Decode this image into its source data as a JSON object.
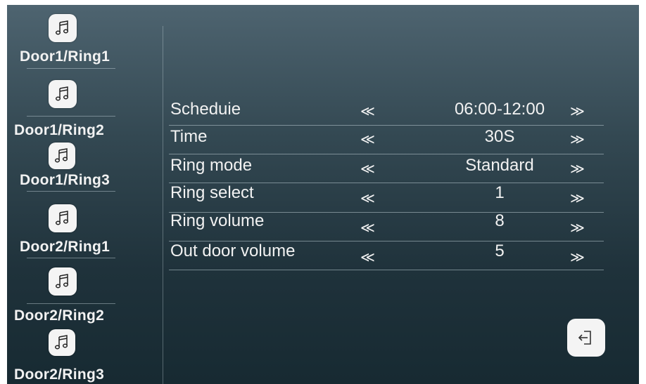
{
  "sidebar": {
    "items": [
      {
        "label": "Door1/Ring1",
        "icon": "music-note-icon"
      },
      {
        "label": "Door1/Ring2",
        "icon": "music-note-icon"
      },
      {
        "label": "Door1/Ring3",
        "icon": "music-note-icon"
      },
      {
        "label": "Door2/Ring1",
        "icon": "music-note-icon"
      },
      {
        "label": "Door2/Ring2",
        "icon": "music-note-icon"
      },
      {
        "label": "Door2/Ring3",
        "icon": "music-note-icon"
      }
    ]
  },
  "settings": {
    "rows": [
      {
        "label": "Scheduie",
        "value": "06:00-12:00",
        "prev": "≪",
        "next": "≫"
      },
      {
        "label": "Time",
        "value": "30S",
        "prev": "≪",
        "next": "≫"
      },
      {
        "label": "Ring mode",
        "value": "Standard",
        "prev": "≪",
        "next": "≫"
      },
      {
        "label": "Ring select",
        "value": "1",
        "prev": "≪",
        "next": "≫"
      },
      {
        "label": "Ring volume",
        "value": "8",
        "prev": "≪",
        "next": "≫"
      },
      {
        "label": "Out door volume",
        "value": "5",
        "prev": "≪",
        "next": "≫"
      }
    ]
  },
  "back_button": {
    "icon": "back-exit-icon"
  },
  "colors": {
    "text": "#f2f2f2",
    "icon_bg": "#f4f4f4",
    "bg_top": "#4e6470",
    "bg_bottom": "#172a32"
  }
}
